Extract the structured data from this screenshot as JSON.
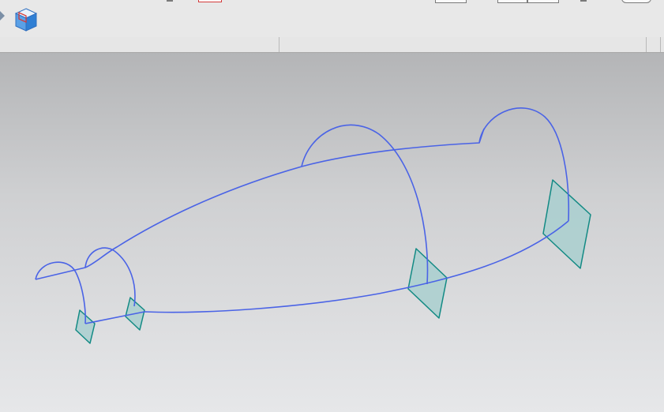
{
  "toolbar": {
    "buttons": [
      {
        "name": "view-cube-button",
        "icon": "view-cube-icon"
      }
    ],
    "accent_colors": {
      "icon_blue": "#3f86d8",
      "icon_red": "#d23a3a"
    }
  },
  "viewport": {
    "background": {
      "top": "#b4b5b7",
      "bottom": "#e6e7e9"
    },
    "curve_color": "#4a63e6",
    "plane_fill": "#a9cfcf",
    "plane_edge": "#128a84",
    "objects": [
      {
        "name": "guide-curve",
        "type": "curve"
      },
      {
        "name": "section-arc-1",
        "type": "arc"
      },
      {
        "name": "section-arc-2",
        "type": "arc"
      },
      {
        "name": "section-arc-3",
        "type": "arc"
      },
      {
        "name": "section-arc-4",
        "type": "arc"
      },
      {
        "name": "datum-plane-1",
        "type": "plane"
      },
      {
        "name": "datum-plane-2",
        "type": "plane"
      },
      {
        "name": "datum-plane-3",
        "type": "plane"
      },
      {
        "name": "datum-plane-4",
        "type": "plane"
      }
    ]
  }
}
